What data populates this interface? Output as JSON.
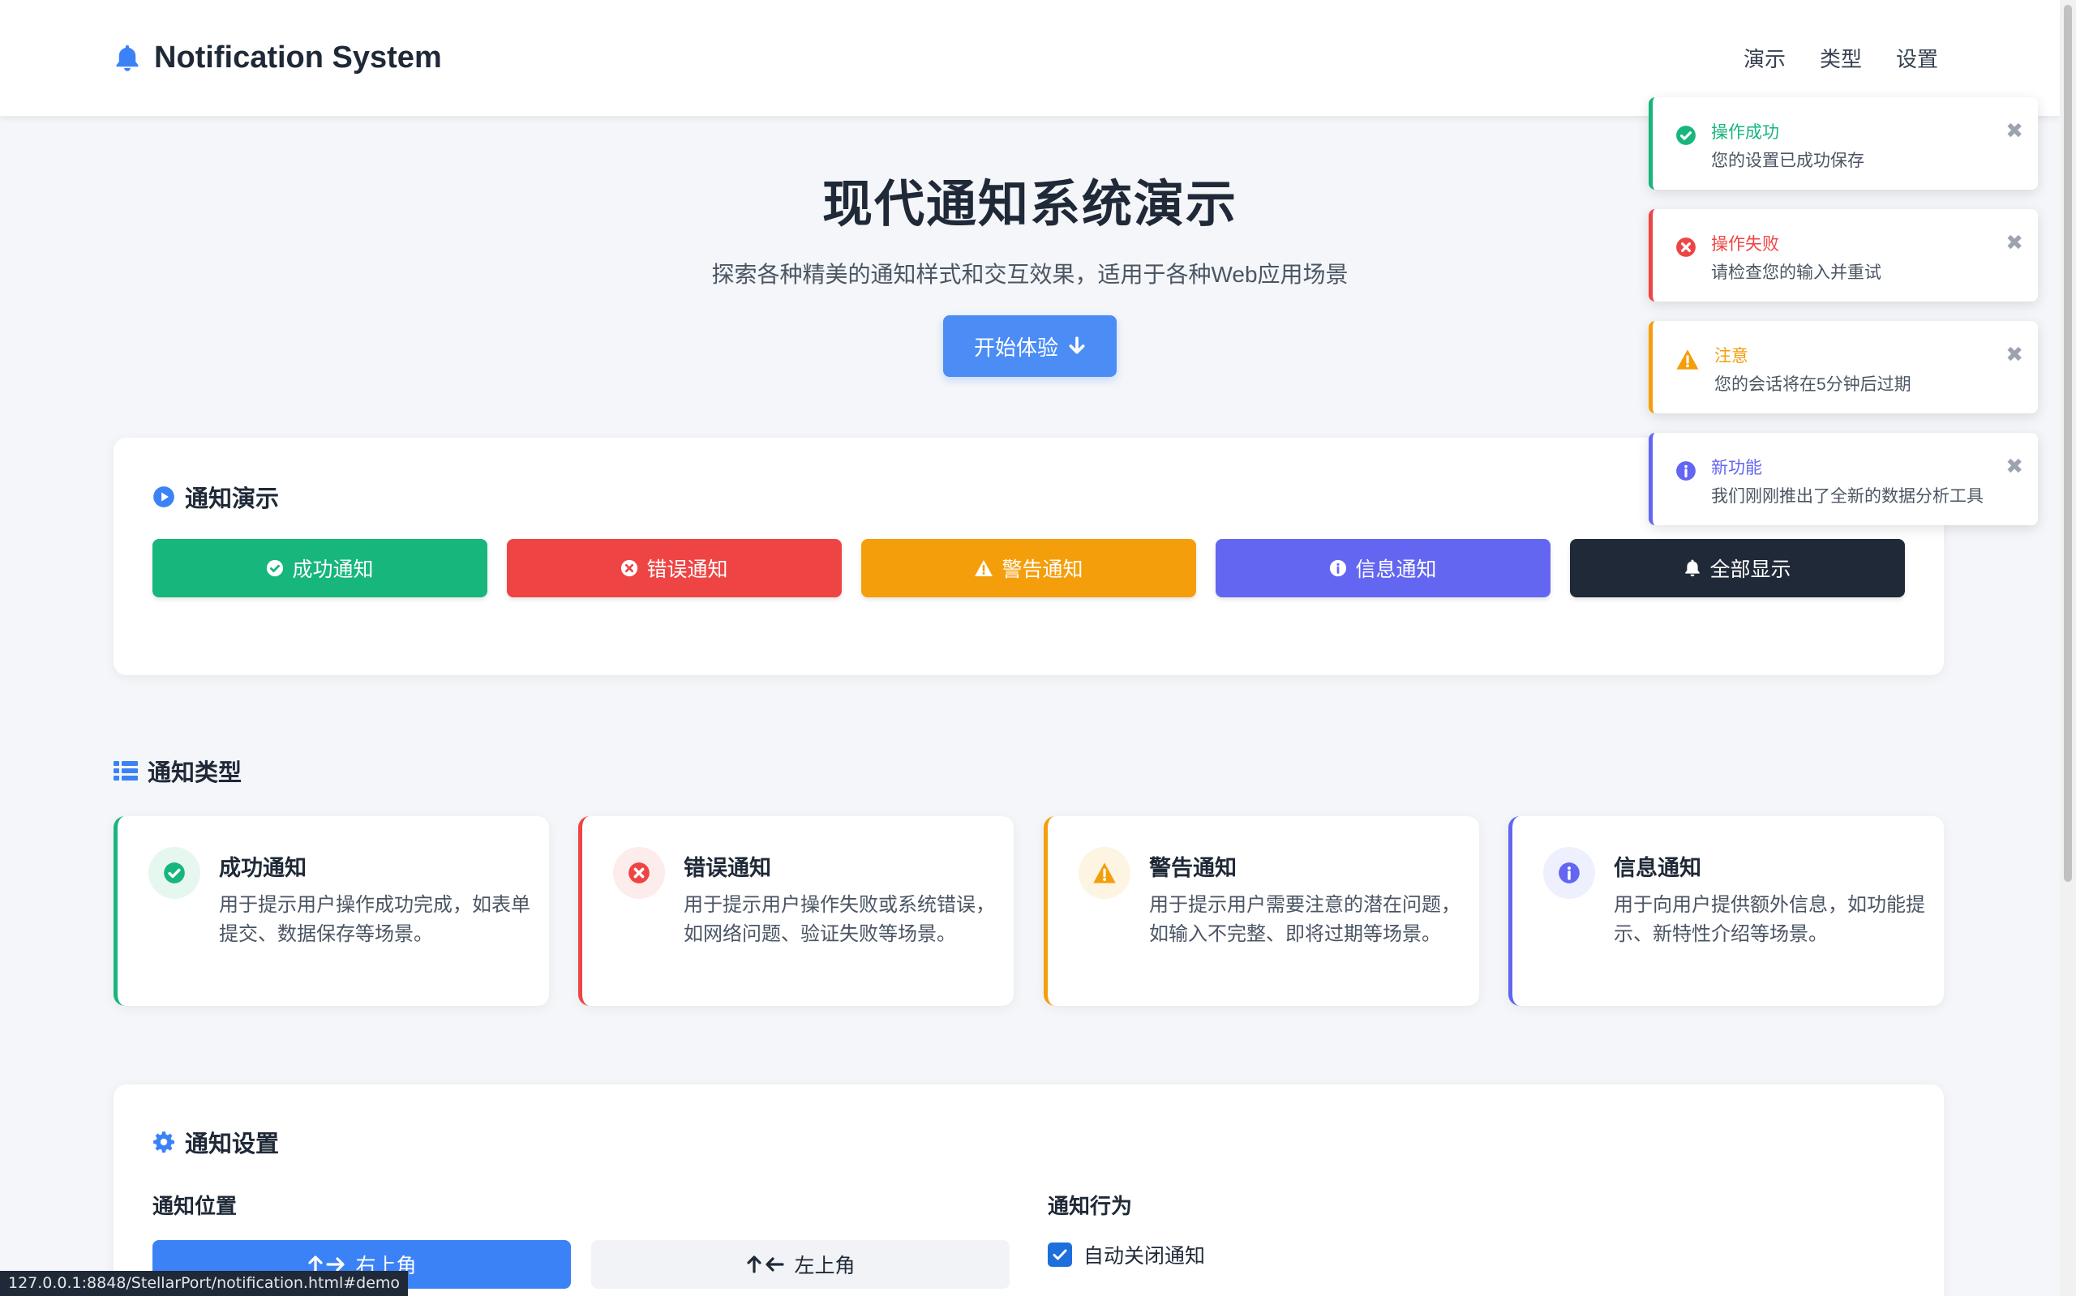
{
  "header": {
    "brand_icon": "bell-icon",
    "title": "Notification System",
    "nav": [
      "演示",
      "类型",
      "设置"
    ]
  },
  "hero": {
    "title": "现代通知系统演示",
    "subtitle": "探索各种精美的通知样式和交互效果，适用于各种Web应用场景",
    "cta_label": "开始体验",
    "cta_icon": "arrow-down-icon"
  },
  "demo": {
    "title": "通知演示",
    "buttons": [
      {
        "label": "成功通知",
        "icon": "check-circle-icon",
        "color": "#16b67c"
      },
      {
        "label": "错误通知",
        "icon": "x-circle-icon",
        "color": "#ef4444"
      },
      {
        "label": "警告通知",
        "icon": "warning-icon",
        "color": "#f59e0b"
      },
      {
        "label": "信息通知",
        "icon": "info-icon",
        "color": "#6366f1"
      },
      {
        "label": "全部显示",
        "icon": "bell-icon",
        "color": "#1f2937"
      }
    ]
  },
  "types": {
    "title": "通知类型",
    "items": [
      {
        "name": "成功通知",
        "desc": "用于提示用户操作成功完成，如表单提交、数据保存等场景。",
        "color": "#16b67c"
      },
      {
        "name": "错误通知",
        "desc": "用于提示用户操作失败或系统错误，如网络问题、验证失败等场景。",
        "color": "#ef4444"
      },
      {
        "name": "警告通知",
        "desc": "用于提示用户需要注意的潜在问题，如输入不完整、即将过期等场景。",
        "color": "#f59e0b"
      },
      {
        "name": "信息通知",
        "desc": "用于向用户提供额外信息，如功能提示、新特性介绍等场景。",
        "color": "#6366f1"
      }
    ]
  },
  "settings": {
    "title": "通知设置",
    "position_title": "通知位置",
    "position_buttons": [
      "右上角",
      "左上角"
    ],
    "behavior_title": "通知行为",
    "auto_close_label": "自动关闭通知",
    "auto_close_checked": true
  },
  "toasts": [
    {
      "title": "操作成功",
      "message": "您的设置已成功保存",
      "color": "#16b67c",
      "icon": "check-circle-icon"
    },
    {
      "title": "操作失败",
      "message": "请检查您的输入并重试",
      "color": "#ef4444",
      "icon": "x-circle-icon"
    },
    {
      "title": "注意",
      "message": "您的会话将在5分钟后过期",
      "color": "#f59e0b",
      "icon": "warning-icon"
    },
    {
      "title": "新功能",
      "message": "我们刚刚推出了全新的数据分析工具",
      "color": "#6366f1",
      "icon": "info-icon"
    }
  ],
  "status_bar": {
    "url": "127.0.0.1:8848/StellarPort/notification.html#demo"
  }
}
